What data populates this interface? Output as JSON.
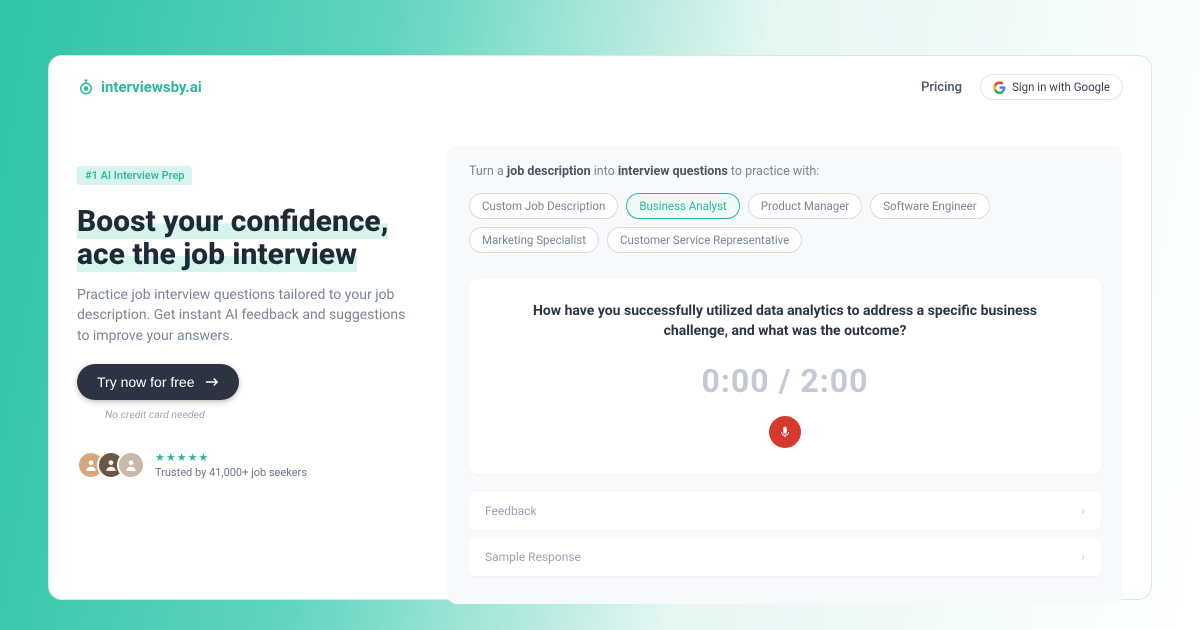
{
  "brand": {
    "name": "interviewsby.ai"
  },
  "nav": {
    "pricing": "Pricing",
    "signin": "Sign in with Google"
  },
  "hero": {
    "badge": "#1 AI Interview Prep",
    "headline_line1": "Boost your confidence,",
    "headline_line2": "ace the job interview",
    "subtext": "Practice job interview questions tailored to your job description. Get instant AI feedback and suggestions to improve your answers.",
    "cta": "Try now for free",
    "cta_sub": "No credit card needed",
    "trusted": "Trusted by 41,000+ job seekers"
  },
  "practice": {
    "prompt_pre": "Turn a ",
    "prompt_bold1": "job description",
    "prompt_mid": " into ",
    "prompt_bold2": "interview questions",
    "prompt_post": " to practice with:",
    "roles": [
      {
        "label": "Custom Job Description",
        "active": false
      },
      {
        "label": "Business Analyst",
        "active": true
      },
      {
        "label": "Product Manager",
        "active": false
      },
      {
        "label": "Software Engineer",
        "active": false
      },
      {
        "label": "Marketing Specialist",
        "active": false
      },
      {
        "label": "Customer Service Representative",
        "active": false
      }
    ],
    "question": "How have you successfully utilized data analytics to address a specific business challenge, and what was the outcome?",
    "timer_current": "0:00",
    "timer_total": "2:00",
    "accordion": {
      "feedback": "Feedback",
      "sample": "Sample Response"
    }
  }
}
